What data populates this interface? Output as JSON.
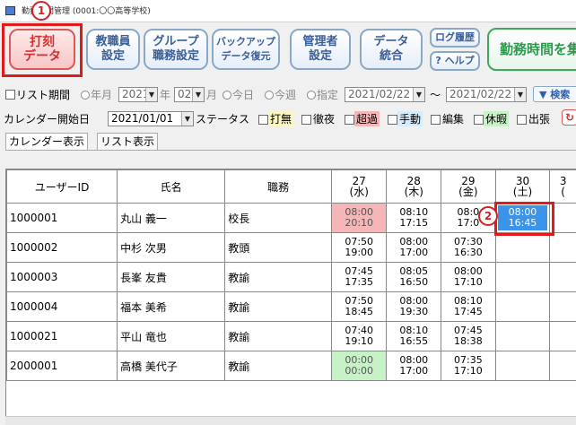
{
  "window": {
    "title": "勤務時間管理 (0001:〇〇高等学校)"
  },
  "badges": {
    "b1": "1",
    "b2": "2"
  },
  "toolbar": {
    "punch": "打刻\nデータ",
    "staff": "教職員\n設定",
    "group": "グループ\n職務設定",
    "backup": "バックアップ\nデータ復元",
    "admin": "管理者\n設定",
    "merge": "データ\n統合",
    "log": "ログ履歴",
    "help": "? ヘルプ",
    "worktime": "勤務時間を集"
  },
  "filters": {
    "list_period": "リスト期間",
    "year_label": "年月",
    "year": "2021",
    "year_unit": "年",
    "month": "02",
    "month_unit": "月",
    "today": "今日",
    "this_week": "今週",
    "specified": "指定",
    "date_from": "2021/02/22",
    "tilde": "～",
    "date_to": "2021/02/22",
    "search": "▼ 検索"
  },
  "calendar": {
    "start_label": "カレンダー開始日",
    "start_date": "2021/01/01",
    "status_label": "ステータス",
    "statuses": [
      "打無",
      "徹夜",
      "超過",
      "手動",
      "編集",
      "休暇",
      "出張"
    ]
  },
  "tabs": [
    "カレンダー表示",
    "リスト表示"
  ],
  "grid": {
    "headers": {
      "user_id": "ユーザーID",
      "name": "氏名",
      "role": "職務"
    },
    "dates": [
      {
        "day": "27",
        "dow": "(水)"
      },
      {
        "day": "28",
        "dow": "(木)"
      },
      {
        "day": "29",
        "dow": "(金)"
      },
      {
        "day": "30",
        "dow": "(土)"
      },
      {
        "day": "3",
        "dow": "("
      }
    ],
    "rows": [
      {
        "id": "1000001",
        "name": "丸山 義一",
        "role": "校長",
        "times": [
          [
            "08:00",
            "20:10"
          ],
          [
            "08:10",
            "17:15"
          ],
          [
            "08:0",
            "17:0"
          ],
          [
            "08:00",
            "16:45"
          ],
          [
            "",
            ""
          ]
        ]
      },
      {
        "id": "1000002",
        "name": "中杉 次男",
        "role": "教頭",
        "times": [
          [
            "07:50",
            "19:00"
          ],
          [
            "08:00",
            "17:00"
          ],
          [
            "07:30",
            "16:30"
          ],
          [
            "",
            ""
          ],
          [
            "",
            ""
          ]
        ]
      },
      {
        "id": "1000003",
        "name": "長峯 友貴",
        "role": "教諭",
        "times": [
          [
            "07:45",
            "17:35"
          ],
          [
            "08:05",
            "16:50"
          ],
          [
            "08:00",
            "17:10"
          ],
          [
            "",
            ""
          ],
          [
            "",
            ""
          ]
        ]
      },
      {
        "id": "1000004",
        "name": "福本 美希",
        "role": "教諭",
        "times": [
          [
            "07:50",
            "18:45"
          ],
          [
            "08:00",
            "19:30"
          ],
          [
            "08:10",
            "17:45"
          ],
          [
            "",
            ""
          ],
          [
            "",
            ""
          ]
        ]
      },
      {
        "id": "1000021",
        "name": "平山 竜也",
        "role": "教諭",
        "times": [
          [
            "07:40",
            "19:10"
          ],
          [
            "08:10",
            "16:55"
          ],
          [
            "07:45",
            "18:38"
          ],
          [
            "",
            ""
          ],
          [
            "",
            ""
          ]
        ]
      },
      {
        "id": "2000001",
        "name": "高橋 美代子",
        "role": "教諭",
        "times": [
          [
            "00:00",
            "00:00"
          ],
          [
            "08:00",
            "17:00"
          ],
          [
            "07:35",
            "17:10"
          ],
          [
            "",
            ""
          ],
          [
            "",
            ""
          ]
        ]
      }
    ]
  },
  "colors": {
    "overtime": "#f4b6b6",
    "vacation": "#c7f2c7",
    "selected": "#3b93ea"
  }
}
